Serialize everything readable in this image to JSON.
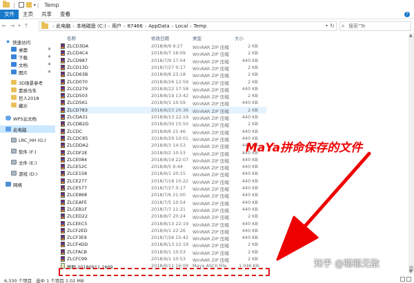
{
  "window": {
    "title": "Temp",
    "quick_access_sep": "|",
    "dropdown": "▾"
  },
  "ribbon": {
    "tabs": [
      "文件",
      "主页",
      "共享",
      "查看"
    ],
    "help": "?"
  },
  "address": {
    "back": "←",
    "forward": "→",
    "recent": "▾",
    "up": "↑",
    "crumbs": [
      "此电脑",
      "本地磁盘 (C:)",
      "用户",
      "87466",
      "AppData",
      "Local",
      "Temp"
    ],
    "chevron": "›",
    "search_placeholder": "搜索\"Te",
    "search_icon": "⌕"
  },
  "nav": {
    "items": [
      {
        "label": "快速访问",
        "icon": "star-icon",
        "pinned": false
      },
      {
        "label": "桌面",
        "icon": "desktop-icon",
        "pinned": true
      },
      {
        "label": "下载",
        "icon": "download-icon",
        "pinned": true
      },
      {
        "label": "文档",
        "icon": "documents-icon",
        "pinned": true
      },
      {
        "label": "图片",
        "icon": "pictures-icon",
        "pinned": true
      },
      {
        "label": "3D场景参考",
        "icon": "folder-icon",
        "pinned": false
      },
      {
        "label": "素质马车",
        "icon": "folder-icon",
        "pinned": false
      },
      {
        "label": "巨人2018",
        "icon": "folder-icon",
        "pinned": false
      },
      {
        "label": "藏示",
        "icon": "folder-icon",
        "pinned": false
      },
      {
        "label": "WPS云文档",
        "icon": "cloud-icon",
        "pinned": false
      },
      {
        "label": "此电脑",
        "icon": "computer-icon",
        "pinned": false
      },
      {
        "label": "LRC_HH (G:)",
        "icon": "drive-icon",
        "pinned": false
      },
      {
        "label": "软件 (F:)",
        "icon": "drive-icon",
        "pinned": false
      },
      {
        "label": "文件 (E:)",
        "icon": "drive-icon",
        "pinned": false
      },
      {
        "label": "游戏 (D:)",
        "icon": "drive-icon",
        "pinned": false
      },
      {
        "label": "网络",
        "icon": "network-icon",
        "pinned": false
      }
    ],
    "pin_glyph": "✱"
  },
  "columns": {
    "name": "名称",
    "date": "修改日期",
    "type": "类型",
    "size": "大小"
  },
  "files": [
    {
      "name": "ZLCD3DA",
      "date": "2018/8/9 9:27",
      "type": "WinRAR ZIP 压缩",
      "size": "2 KB"
    },
    {
      "name": "ZLCD4C4",
      "date": "2018/9/7 16:09",
      "type": "WinRAR ZIP 压缩",
      "size": "2 KB"
    },
    {
      "name": "ZLCD987",
      "date": "2018/7/9 17:04",
      "type": "WinRAR ZIP 压缩",
      "size": "440 KB"
    },
    {
      "name": "ZLCD13D",
      "date": "2018/7/27 0:17",
      "type": "WinRAR ZIP 压缩",
      "size": "2 KB"
    },
    {
      "name": "ZLCD63B",
      "date": "2018/8/8 23:18",
      "type": "WinRAR ZIP 压缩",
      "size": "2 KB"
    },
    {
      "name": "ZLCD070",
      "date": "2018/8/26 12:59",
      "type": "WinRAR ZIP 压缩",
      "size": "2 KB"
    },
    {
      "name": "ZLCD279",
      "date": "2018/8/22 17:58",
      "type": "WinRAR ZIP 压缩",
      "size": "440 KB"
    },
    {
      "name": "ZLCD503",
      "date": "2018/8/19 13:42",
      "type": "WinRAR ZIP 压缩",
      "size": "2 KB"
    },
    {
      "name": "ZLCD561",
      "date": "2018/9/1 10:59",
      "type": "WinRAR ZIP 压缩",
      "size": "440 KB"
    },
    {
      "name": "ZLCD783",
      "date": "2018/8/23 20:36",
      "type": "WinRAR ZIP 压缩",
      "size": "2 KB"
    },
    {
      "name": "ZLCDA31",
      "date": "2018/8/13 22:19",
      "type": "WinRAR ZIP 压缩",
      "size": "440 KB"
    },
    {
      "name": "ZLCDB2D",
      "date": "2018/8/30 15:50",
      "type": "WinRAR ZIP 压缩",
      "size": "2 KB"
    },
    {
      "name": "ZLCDC",
      "date": "2018/8/6 21:46",
      "type": "WinRAR ZIP 压缩",
      "size": "440 KB"
    },
    {
      "name": "ZLCDC85",
      "date": "2018/6/29 10:01",
      "type": "WinRAR ZIP 压缩",
      "size": "440 KB"
    },
    {
      "name": "ZLCDDA2",
      "date": "2018/8/3 14:53",
      "type": "WinRAR ZIP 压缩",
      "size": "440 KB"
    },
    {
      "name": "ZLCDF2E",
      "date": "2018/9/2 10:53",
      "type": "WinRAR ZIP 压缩",
      "size": "440 KB"
    },
    {
      "name": "ZLCE084",
      "date": "2018/8/19 22:07",
      "type": "WinRAR ZIP 压缩",
      "size": "440 KB"
    },
    {
      "name": "ZLCE52C",
      "date": "2018/8/5 9:44",
      "type": "WinRAR ZIP 压缩",
      "size": "440 KB"
    },
    {
      "name": "ZLCE158",
      "date": "2018/9/1 20:15",
      "type": "WinRAR ZIP 压缩",
      "size": "440 KB"
    },
    {
      "name": "ZLCE277",
      "date": "2018/7/18 10:22",
      "type": "WinRAR ZIP 压缩",
      "size": "440 KB"
    },
    {
      "name": "ZLCE577",
      "date": "2018/7/27 0:17",
      "type": "WinRAR ZIP 压缩",
      "size": "440 KB"
    },
    {
      "name": "ZLCE868",
      "date": "2018/7/6 21:00",
      "type": "WinRAR ZIP 压缩",
      "size": "440 KB"
    },
    {
      "name": "ZLCEAFE",
      "date": "2018/7/5 10:54",
      "type": "WinRAR ZIP 压缩",
      "size": "440 KB"
    },
    {
      "name": "ZLCEB1F",
      "date": "2018/7/7 11:21",
      "type": "WinRAR ZIP 压缩",
      "size": "440 KB"
    },
    {
      "name": "ZLCED22",
      "date": "2018/8/7 20:24",
      "type": "WinRAR ZIP 压缩",
      "size": "2 KB"
    },
    {
      "name": "ZLCEEC5",
      "date": "2018/8/13 22:19",
      "type": "WinRAR ZIP 压缩",
      "size": "440 KB"
    },
    {
      "name": "ZLCF2ED",
      "date": "2018/9/1 22:26",
      "type": "WinRAR ZIP 压缩",
      "size": "440 KB"
    },
    {
      "name": "ZLCF3E9",
      "date": "2018/7/26 15:42",
      "type": "WinRAR ZIP 压缩",
      "size": "440 KB"
    },
    {
      "name": "ZLCF4DD",
      "date": "2018/8/13 22:19",
      "type": "WinRAR ZIP 压缩",
      "size": "2 KB"
    },
    {
      "name": "ZLCFACB",
      "date": "2018/9/1 10:53",
      "type": "WinRAR ZIP 压缩",
      "size": "2 KB"
    },
    {
      "name": "ZLCFC99",
      "date": "2018/9/1 10:53",
      "type": "WinRAR ZIP 压缩",
      "size": "2 KB"
    },
    {
      "name": "聪聪.20180911.1609",
      "date": "2018/9/11 16:09",
      "type": "Maya ASCII File",
      "size": "1,046 KB"
    }
  ],
  "highlighted_row": 9,
  "status": {
    "count": "6,330 个项目",
    "selection": "选中 1 个项目  1.02 MB"
  },
  "annotation": {
    "text": "MaYa拼命保存的文件",
    "color": "#ee0000"
  },
  "watermark": "知乎 @聪聪无敌",
  "colors": {
    "accent": "#1979ca",
    "selection": "#cce8ff",
    "hover": "#e5f3ff"
  }
}
